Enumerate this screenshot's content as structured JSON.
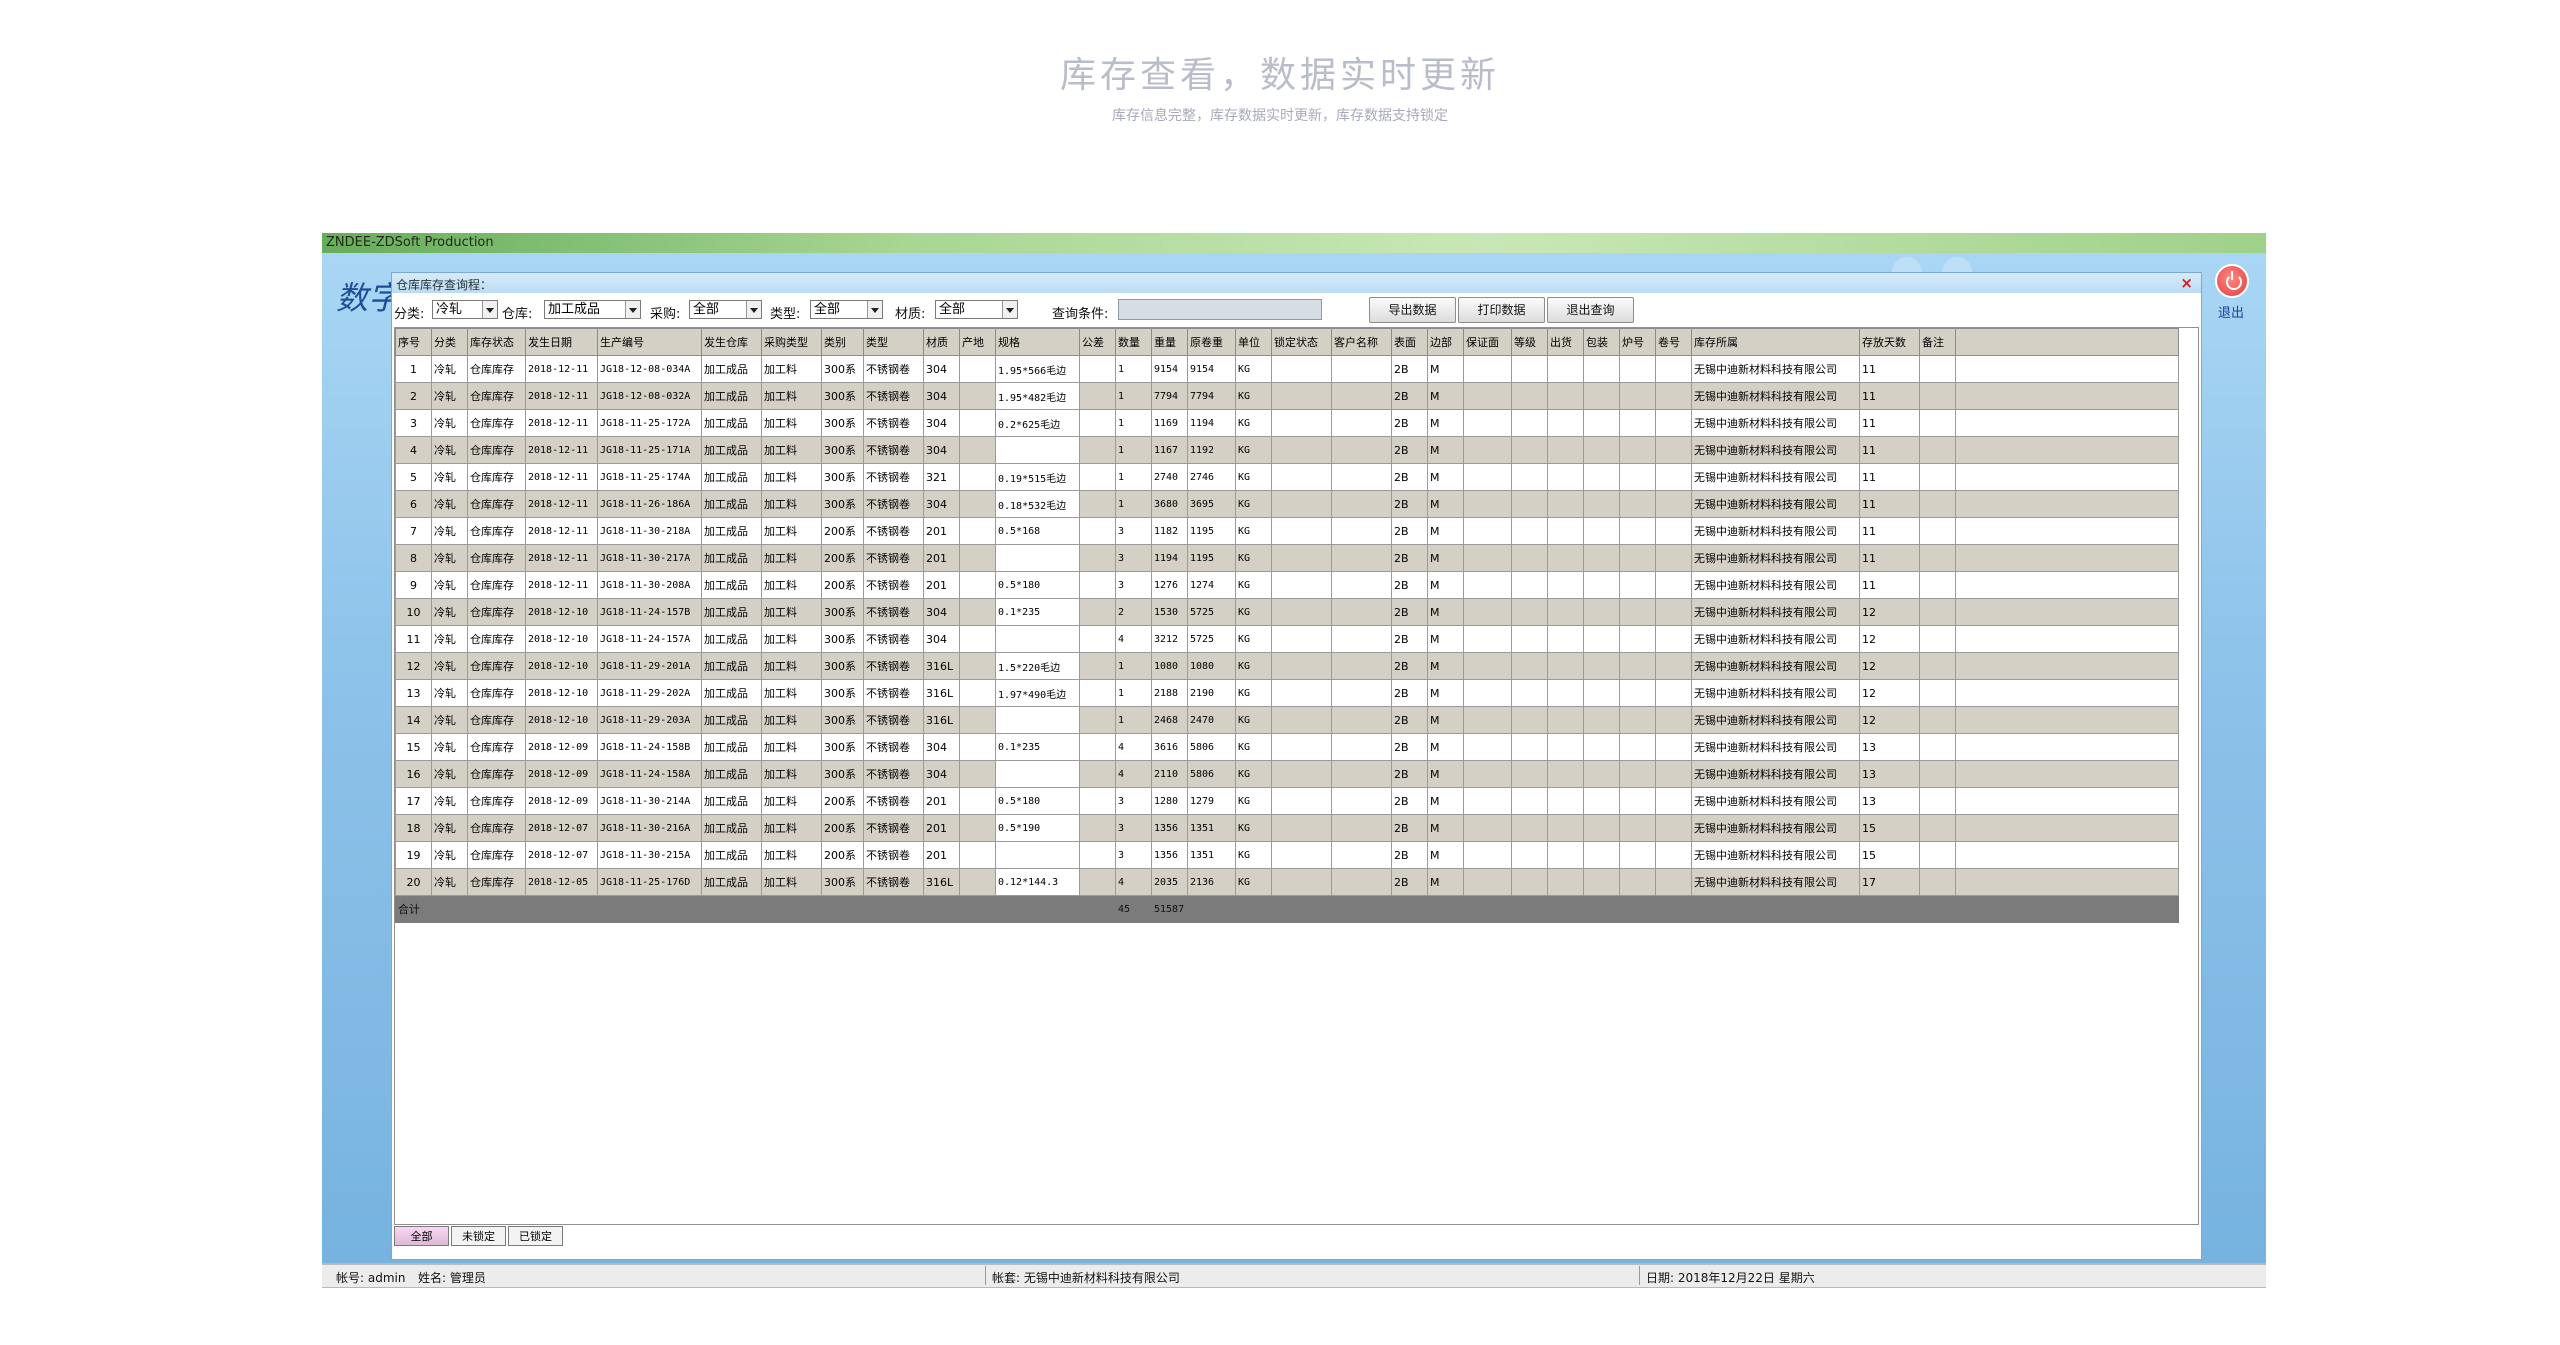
{
  "hero": {
    "title": "库存查看，数据实时更新",
    "subtitle": "库存信息完整，库存数据实时更新，库存数据支持锁定"
  },
  "app": {
    "window_title": "ZNDEE-ZDSoft Production",
    "logo_text": "数字",
    "exit_label": "退出"
  },
  "panel": {
    "title": "仓库库存查询程：",
    "close_label": "×"
  },
  "filters": {
    "category_label": "分类:",
    "category_value": "冷轧",
    "warehouse_label": "仓库:",
    "warehouse_value": "加工成品",
    "purchase_label": "采购:",
    "purchase_value": "全部",
    "type_label": "类型:",
    "type_value": "全部",
    "material_label": "材质:",
    "material_value": "全部",
    "query_label": "查询条件:",
    "query_value": ""
  },
  "buttons": {
    "export": "导出数据",
    "print": "打印数据",
    "exit_query": "退出查询"
  },
  "table": {
    "columns": [
      "序号",
      "分类",
      "库存状态",
      "发生日期",
      "生产编号",
      "发生仓库",
      "采购类型",
      "类别",
      "类型",
      "材质",
      "产地",
      "规格",
      "公差",
      "数量",
      "重量",
      "原卷重",
      "单位",
      "锁定状态",
      "客户名称",
      "表面",
      "边部",
      "保证面",
      "等级",
      "出货",
      "包装",
      "炉号",
      "卷号",
      "库存所属",
      "存放天数",
      "备注"
    ],
    "rows": [
      {
        "no": "1",
        "cat": "冷轧",
        "status": "仓库库存",
        "date": "2018-12-11",
        "code": "JG18-12-08-034A",
        "wh": "加工成品",
        "ptype": "加工料",
        "series": "300系",
        "kind": "不锈钢卷",
        "mat": "304",
        "spec": "1.95*566毛边",
        "qty": "1",
        "weight": "9154",
        "orig": "9154",
        "unit": "KG",
        "surface": "2B",
        "edge": "M",
        "owner": "无锡中迪新材料科技有限公司",
        "days": "11"
      },
      {
        "no": "2",
        "cat": "冷轧",
        "status": "仓库库存",
        "date": "2018-12-11",
        "code": "JG18-12-08-032A",
        "wh": "加工成品",
        "ptype": "加工料",
        "series": "300系",
        "kind": "不锈钢卷",
        "mat": "304",
        "spec": "1.95*482毛边",
        "qty": "1",
        "weight": "7794",
        "orig": "7794",
        "unit": "KG",
        "surface": "2B",
        "edge": "M",
        "owner": "无锡中迪新材料科技有限公司",
        "days": "11"
      },
      {
        "no": "3",
        "cat": "冷轧",
        "status": "仓库库存",
        "date": "2018-12-11",
        "code": "JG18-11-25-172A",
        "wh": "加工成品",
        "ptype": "加工料",
        "series": "300系",
        "kind": "不锈钢卷",
        "mat": "304",
        "spec": "0.2*625毛边",
        "qty": "1",
        "weight": "1169",
        "orig": "1194",
        "unit": "KG",
        "surface": "2B",
        "edge": "M",
        "owner": "无锡中迪新材料科技有限公司",
        "days": "11"
      },
      {
        "no": "4",
        "cat": "冷轧",
        "status": "仓库库存",
        "date": "2018-12-11",
        "code": "JG18-11-25-171A",
        "wh": "加工成品",
        "ptype": "加工料",
        "series": "300系",
        "kind": "不锈钢卷",
        "mat": "304",
        "spec": "",
        "qty": "1",
        "weight": "1167",
        "orig": "1192",
        "unit": "KG",
        "surface": "2B",
        "edge": "M",
        "owner": "无锡中迪新材料科技有限公司",
        "days": "11"
      },
      {
        "no": "5",
        "cat": "冷轧",
        "status": "仓库库存",
        "date": "2018-12-11",
        "code": "JG18-11-25-174A",
        "wh": "加工成品",
        "ptype": "加工料",
        "series": "300系",
        "kind": "不锈钢卷",
        "mat": "321",
        "spec": "0.19*515毛边",
        "qty": "1",
        "weight": "2740",
        "orig": "2746",
        "unit": "KG",
        "surface": "2B",
        "edge": "M",
        "owner": "无锡中迪新材料科技有限公司",
        "days": "11"
      },
      {
        "no": "6",
        "cat": "冷轧",
        "status": "仓库库存",
        "date": "2018-12-11",
        "code": "JG18-11-26-186A",
        "wh": "加工成品",
        "ptype": "加工料",
        "series": "300系",
        "kind": "不锈钢卷",
        "mat": "304",
        "spec": "0.18*532毛边",
        "qty": "1",
        "weight": "3680",
        "orig": "3695",
        "unit": "KG",
        "surface": "2B",
        "edge": "M",
        "owner": "无锡中迪新材料科技有限公司",
        "days": "11"
      },
      {
        "no": "7",
        "cat": "冷轧",
        "status": "仓库库存",
        "date": "2018-12-11",
        "code": "JG18-11-30-218A",
        "wh": "加工成品",
        "ptype": "加工料",
        "series": "200系",
        "kind": "不锈钢卷",
        "mat": "201",
        "spec": "0.5*168",
        "qty": "3",
        "weight": "1182",
        "orig": "1195",
        "unit": "KG",
        "surface": "2B",
        "edge": "M",
        "owner": "无锡中迪新材料科技有限公司",
        "days": "11"
      },
      {
        "no": "8",
        "cat": "冷轧",
        "status": "仓库库存",
        "date": "2018-12-11",
        "code": "JG18-11-30-217A",
        "wh": "加工成品",
        "ptype": "加工料",
        "series": "200系",
        "kind": "不锈钢卷",
        "mat": "201",
        "spec": "",
        "qty": "3",
        "weight": "1194",
        "orig": "1195",
        "unit": "KG",
        "surface": "2B",
        "edge": "M",
        "owner": "无锡中迪新材料科技有限公司",
        "days": "11"
      },
      {
        "no": "9",
        "cat": "冷轧",
        "status": "仓库库存",
        "date": "2018-12-11",
        "code": "JG18-11-30-208A",
        "wh": "加工成品",
        "ptype": "加工料",
        "series": "200系",
        "kind": "不锈钢卷",
        "mat": "201",
        "spec": "0.5*180",
        "qty": "3",
        "weight": "1276",
        "orig": "1274",
        "unit": "KG",
        "surface": "2B",
        "edge": "M",
        "owner": "无锡中迪新材料科技有限公司",
        "days": "11"
      },
      {
        "no": "10",
        "cat": "冷轧",
        "status": "仓库库存",
        "date": "2018-12-10",
        "code": "JG18-11-24-157B",
        "wh": "加工成品",
        "ptype": "加工料",
        "series": "300系",
        "kind": "不锈钢卷",
        "mat": "304",
        "spec": "0.1*235",
        "qty": "2",
        "weight": "1530",
        "orig": "5725",
        "unit": "KG",
        "surface": "2B",
        "edge": "M",
        "owner": "无锡中迪新材料科技有限公司",
        "days": "12"
      },
      {
        "no": "11",
        "cat": "冷轧",
        "status": "仓库库存",
        "date": "2018-12-10",
        "code": "JG18-11-24-157A",
        "wh": "加工成品",
        "ptype": "加工料",
        "series": "300系",
        "kind": "不锈钢卷",
        "mat": "304",
        "spec": "",
        "qty": "4",
        "weight": "3212",
        "orig": "5725",
        "unit": "KG",
        "surface": "2B",
        "edge": "M",
        "owner": "无锡中迪新材料科技有限公司",
        "days": "12"
      },
      {
        "no": "12",
        "cat": "冷轧",
        "status": "仓库库存",
        "date": "2018-12-10",
        "code": "JG18-11-29-201A",
        "wh": "加工成品",
        "ptype": "加工料",
        "series": "300系",
        "kind": "不锈钢卷",
        "mat": "316L",
        "spec": "1.5*220毛边",
        "qty": "1",
        "weight": "1080",
        "orig": "1080",
        "unit": "KG",
        "surface": "2B",
        "edge": "M",
        "owner": "无锡中迪新材料科技有限公司",
        "days": "12"
      },
      {
        "no": "13",
        "cat": "冷轧",
        "status": "仓库库存",
        "date": "2018-12-10",
        "code": "JG18-11-29-202A",
        "wh": "加工成品",
        "ptype": "加工料",
        "series": "300系",
        "kind": "不锈钢卷",
        "mat": "316L",
        "spec": "1.97*490毛边",
        "qty": "1",
        "weight": "2188",
        "orig": "2190",
        "unit": "KG",
        "surface": "2B",
        "edge": "M",
        "owner": "无锡中迪新材料科技有限公司",
        "days": "12"
      },
      {
        "no": "14",
        "cat": "冷轧",
        "status": "仓库库存",
        "date": "2018-12-10",
        "code": "JG18-11-29-203A",
        "wh": "加工成品",
        "ptype": "加工料",
        "series": "300系",
        "kind": "不锈钢卷",
        "mat": "316L",
        "spec": "",
        "qty": "1",
        "weight": "2468",
        "orig": "2470",
        "unit": "KG",
        "surface": "2B",
        "edge": "M",
        "owner": "无锡中迪新材料科技有限公司",
        "days": "12"
      },
      {
        "no": "15",
        "cat": "冷轧",
        "status": "仓库库存",
        "date": "2018-12-09",
        "code": "JG18-11-24-158B",
        "wh": "加工成品",
        "ptype": "加工料",
        "series": "300系",
        "kind": "不锈钢卷",
        "mat": "304",
        "spec": "0.1*235",
        "qty": "4",
        "weight": "3616",
        "orig": "5806",
        "unit": "KG",
        "surface": "2B",
        "edge": "M",
        "owner": "无锡中迪新材料科技有限公司",
        "days": "13"
      },
      {
        "no": "16",
        "cat": "冷轧",
        "status": "仓库库存",
        "date": "2018-12-09",
        "code": "JG18-11-24-158A",
        "wh": "加工成品",
        "ptype": "加工料",
        "series": "300系",
        "kind": "不锈钢卷",
        "mat": "304",
        "spec": "",
        "qty": "4",
        "weight": "2110",
        "orig": "5806",
        "unit": "KG",
        "surface": "2B",
        "edge": "M",
        "owner": "无锡中迪新材料科技有限公司",
        "days": "13"
      },
      {
        "no": "17",
        "cat": "冷轧",
        "status": "仓库库存",
        "date": "2018-12-09",
        "code": "JG18-11-30-214A",
        "wh": "加工成品",
        "ptype": "加工料",
        "series": "200系",
        "kind": "不锈钢卷",
        "mat": "201",
        "spec": "0.5*180",
        "qty": "3",
        "weight": "1280",
        "orig": "1279",
        "unit": "KG",
        "surface": "2B",
        "edge": "M",
        "owner": "无锡中迪新材料科技有限公司",
        "days": "13"
      },
      {
        "no": "18",
        "cat": "冷轧",
        "status": "仓库库存",
        "date": "2018-12-07",
        "code": "JG18-11-30-216A",
        "wh": "加工成品",
        "ptype": "加工料",
        "series": "200系",
        "kind": "不锈钢卷",
        "mat": "201",
        "spec": "0.5*190",
        "qty": "3",
        "weight": "1356",
        "orig": "1351",
        "unit": "KG",
        "surface": "2B",
        "edge": "M",
        "owner": "无锡中迪新材料科技有限公司",
        "days": "15"
      },
      {
        "no": "19",
        "cat": "冷轧",
        "status": "仓库库存",
        "date": "2018-12-07",
        "code": "JG18-11-30-215A",
        "wh": "加工成品",
        "ptype": "加工料",
        "series": "200系",
        "kind": "不锈钢卷",
        "mat": "201",
        "spec": "",
        "qty": "3",
        "weight": "1356",
        "orig": "1351",
        "unit": "KG",
        "surface": "2B",
        "edge": "M",
        "owner": "无锡中迪新材料科技有限公司",
        "days": "15"
      },
      {
        "no": "20",
        "cat": "冷轧",
        "status": "仓库库存",
        "date": "2018-12-05",
        "code": "JG18-11-25-176D",
        "wh": "加工成品",
        "ptype": "加工料",
        "series": "300系",
        "kind": "不锈钢卷",
        "mat": "316L",
        "spec": "0.12*144.3",
        "qty": "4",
        "weight": "2035",
        "orig": "2136",
        "unit": "KG",
        "surface": "2B",
        "edge": "M",
        "owner": "无锡中迪新材料科技有限公司",
        "days": "17"
      }
    ],
    "total": {
      "label": "合计",
      "qty": "45",
      "weight": "51587"
    }
  },
  "tabs": [
    "全部",
    "未锁定",
    "已锁定"
  ],
  "status": {
    "account": "帐号: admin",
    "name": "姓名: 管理员",
    "company": "帐套: 无锡中迪新材料科技有限公司",
    "date": "日期: 2018年12月22日 星期六"
  }
}
